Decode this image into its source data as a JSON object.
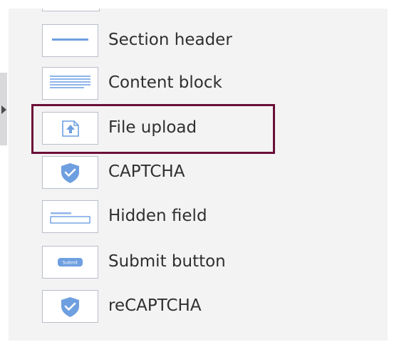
{
  "field_palette": {
    "items": [
      {
        "label": "Section header",
        "icon": "section-header-icon"
      },
      {
        "label": "Content block",
        "icon": "content-block-icon"
      },
      {
        "label": "File upload",
        "icon": "file-upload-icon"
      },
      {
        "label": "CAPTCHA",
        "icon": "shield-icon"
      },
      {
        "label": "Hidden field",
        "icon": "hidden-field-icon"
      },
      {
        "label": "Submit button",
        "icon": "submit-button-icon"
      },
      {
        "label": "reCAPTCHA",
        "icon": "shield-icon"
      }
    ],
    "submit_icon_text": "Submit",
    "selected_item": "File upload"
  },
  "colors": {
    "icon_blue": "#6e9fe0",
    "icon_light_blue": "#a9c6f0",
    "selection_border": "#6b0f37",
    "panel_bg": "#f3f3f4",
    "label_text": "#2f2f2f"
  }
}
